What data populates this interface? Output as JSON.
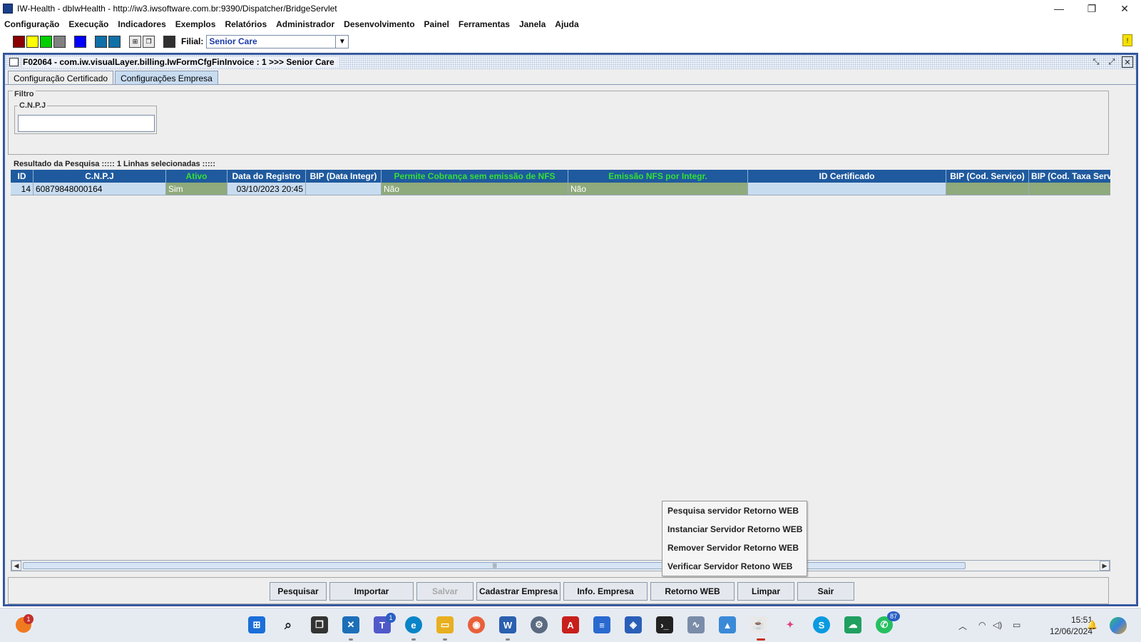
{
  "window": {
    "title": "IW-Health - dbIwHealth - http://iw3.iwsoftware.com.br:9390/Dispatcher/BridgeServlet",
    "minimize": "—",
    "restore": "❐",
    "close": "✕"
  },
  "menu": [
    "Configuração",
    "Execução",
    "Indicadores",
    "Exemplos",
    "Relatórios",
    "Administrador",
    "Desenvolvimento",
    "Painel",
    "Ferramentas",
    "Janela",
    "Ajuda"
  ],
  "toolbar": {
    "swatches": [
      "#8b0000",
      "#ffff00",
      "#00d000",
      "#808080",
      "#0000ff",
      "#1070a8",
      "#1070a8"
    ],
    "filial_label": "Filial:",
    "filial_value": "Senior Care",
    "alert_badge": "!"
  },
  "frame": {
    "title": "F02064 - com.iw.visualLayer.billing.IwFormCfgFinInvoice : 1 >>> Senior Care",
    "tabs": [
      "Configuração Certificado",
      "Configurações Empresa"
    ],
    "active_tab": 1
  },
  "filter": {
    "legend": "Filtro",
    "cnpj_label": "C.N.P.J",
    "cnpj_value": ""
  },
  "results": {
    "label": "Resultado da Pesquisa ::::: 1 Linhas selecionadas :::::",
    "columns": [
      {
        "label": "ID",
        "green": false
      },
      {
        "label": "C.N.P.J",
        "green": false
      },
      {
        "label": "Ativo",
        "green": true
      },
      {
        "label": "Data do Registro",
        "green": false
      },
      {
        "label": "BIP (Data Integr)",
        "green": false
      },
      {
        "label": "Permite Cobrança sem emissão de NFS",
        "green": true
      },
      {
        "label": "Emissão NFS por Integr.",
        "green": true
      },
      {
        "label": "ID Certificado",
        "green": false
      },
      {
        "label": "BIP (Cod. Serviço)",
        "green": false
      },
      {
        "label": "BIP (Cod. Taxa Serv",
        "green": false
      }
    ],
    "rows": [
      [
        "14",
        "60879848000164",
        "Sim",
        "03/10/2023 20:45",
        "",
        "Não",
        "Não",
        "",
        "",
        ""
      ]
    ]
  },
  "buttons": {
    "pesquisar": "Pesquisar",
    "importar": "Importar",
    "salvar": "Salvar",
    "cadastrar": "Cadastrar Empresa",
    "info": "Info. Empresa",
    "retorno": "Retorno WEB",
    "limpar": "Limpar",
    "sair": "Sair"
  },
  "popup": [
    "Pesquisa servidor Retorno WEB",
    "Instanciar Servidor Retorno WEB",
    "Remover Servidor Retorno WEB",
    "Verificar Servidor Retono WEB"
  ],
  "taskbar": {
    "left_badge": "1",
    "teams_badge": "1",
    "whatsapp_badge": "87",
    "time": "15:51",
    "date": "12/06/2024"
  }
}
